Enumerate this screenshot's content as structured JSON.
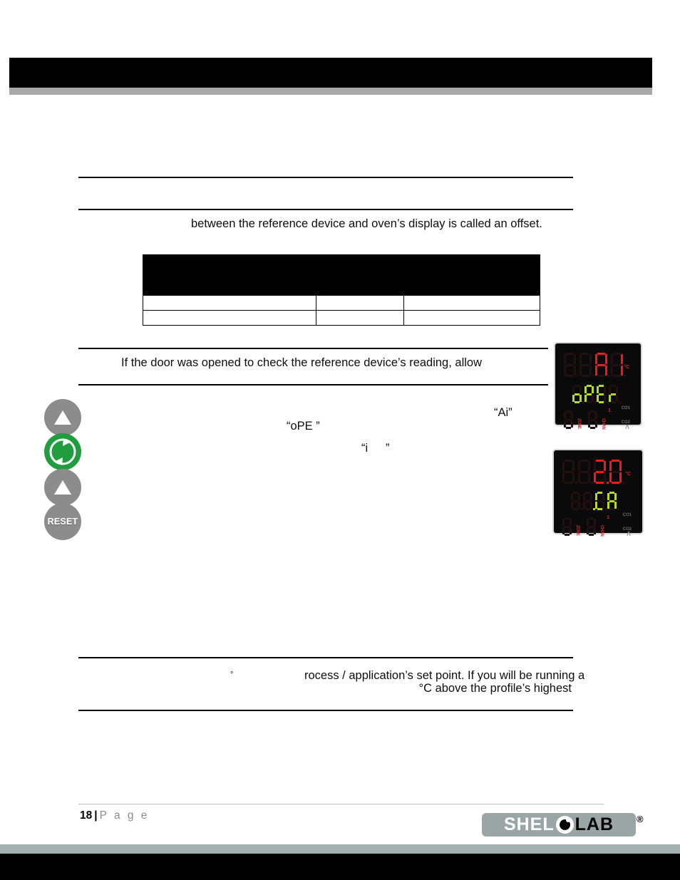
{
  "document": {
    "page_number": "18",
    "page_separator": "|",
    "page_word": "P a g e"
  },
  "header": {
    "banner_text": ""
  },
  "content": {
    "paragraph_offset": "between the reference device and oven’s display is called an offset.",
    "paragraph_door": "If  the  door  was  opened  to  check  the  reference  device’s  reading,  allow",
    "quote_ai": "“Ai”",
    "quote_ope": "“oPE ”",
    "quote_i": "“i",
    "quote_i_close": "”",
    "degree_symbol": "°",
    "paragraph_setpoint_line1": "rocess / application’s set point. If you will be running a",
    "paragraph_setpoint_line2": "°C above the profile’s highest"
  },
  "table": {
    "columns": [
      "",
      "",
      ""
    ],
    "header_labels": [
      "",
      "",
      ""
    ],
    "rows": [
      [
        "",
        "",
        ""
      ],
      [
        "",
        "",
        ""
      ]
    ]
  },
  "control_panel": {
    "buttons": [
      {
        "name": "up-arrow-top",
        "label": "",
        "icon": "triangle-up-icon",
        "color": "#8c8c8c"
      },
      {
        "name": "cycle-green",
        "label": "",
        "icon": "circular-arrows-icon",
        "color": "#1f9d3f"
      },
      {
        "name": "up-arrow-bottom",
        "label": "",
        "icon": "triangle-up-icon",
        "color": "#8c8c8c"
      },
      {
        "name": "reset",
        "label": "RESET",
        "icon": "text-icon",
        "color": "#8c8c8c"
      }
    ]
  },
  "displays": [
    {
      "id": "display-operating-mode",
      "main_value": "Ai",
      "main_digits": [
        "",
        "",
        "A",
        "i"
      ],
      "main_color": "#ee1b1b",
      "sub_value": "oPEr",
      "sub_digits": [
        "o",
        "P",
        "E",
        "r"
      ],
      "sub_color": "#b8d92a",
      "unit": "°C",
      "zone_label": "ZONE",
      "chan_label": "CHAN",
      "chan_index": "1",
      "co_marks": [
        "CO1",
        "CO2"
      ]
    },
    {
      "id": "display-offset-value",
      "main_value": "2.0",
      "main_digits": [
        "",
        "",
        "2",
        "0"
      ],
      "main_color": "#ee1b1b",
      "sub_value": "CA",
      "sub_digits": [
        "",
        "",
        "C",
        "A"
      ],
      "sub_color": "#b8d92a",
      "unit": "°C",
      "zone_label": "ZONE",
      "chan_label": "CHAN",
      "chan_index": "1",
      "co_marks": [
        "CO1",
        "CO2"
      ]
    }
  ],
  "logo": {
    "part_white": "SHEL",
    "part_black": "LAB",
    "registered": "®"
  },
  "colors": {
    "header_bar": "#000000",
    "header_accent": "#aaaaaa",
    "footer_accent": "#a3b0b0",
    "footer_bar": "#000000",
    "led_red": "#ee1b1b",
    "led_green": "#b8d92a",
    "led_off": "#241012",
    "button_gray": "#8c8c8c",
    "button_green": "#1f9d3f",
    "logo_bg": "#9aa5a5"
  }
}
